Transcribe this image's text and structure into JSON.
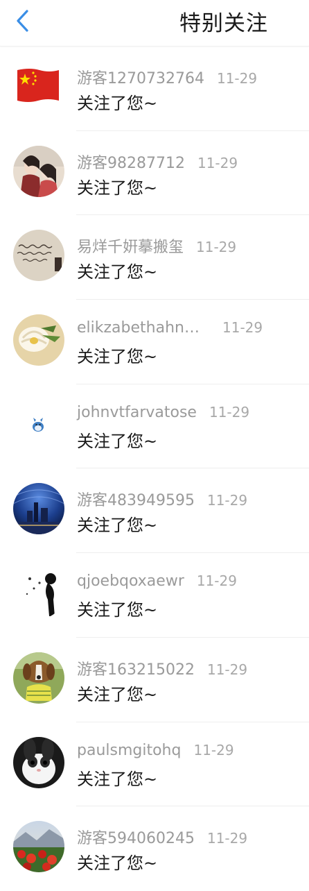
{
  "header": {
    "title": "特别关注",
    "back_icon": "chevron-left-icon",
    "accent_color": "#3a8ee6"
  },
  "items": [
    {
      "name": "游客1270732764",
      "time": "11-29",
      "message": "关注了您~",
      "avatar": "china-flag-avatar"
    },
    {
      "name": "游客98287712",
      "time": "11-29",
      "message": "关注了您~",
      "avatar": "anime-couple-avatar"
    },
    {
      "name": "易烊千姸摹搬玺",
      "time": "11-29",
      "message": "关注了您~",
      "avatar": "handwriting-avatar"
    },
    {
      "name": "elikzabethahn…",
      "time": "11-29",
      "message": "关注了您~",
      "avatar": "flower-avatar"
    },
    {
      "name": "johnvtfarvatose",
      "time": "11-29",
      "message": "关注了您~",
      "avatar": "totoro-avatar"
    },
    {
      "name": "游客483949595",
      "time": "11-29",
      "message": "关注了您~",
      "avatar": "night-city-avatar"
    },
    {
      "name": "qjoebqoxaewr",
      "time": "11-29",
      "message": "关注了您~",
      "avatar": "silhouette-avatar"
    },
    {
      "name": "游客163215022",
      "time": "11-29",
      "message": "关注了您~",
      "avatar": "beagle-avatar"
    },
    {
      "name": "paulsmgitohq",
      "time": "11-29",
      "message": "关注了您~",
      "avatar": "rabbit-avatar"
    },
    {
      "name": "游客594060245",
      "time": "11-29",
      "message": "关注了您~",
      "avatar": "red-flowers-avatar"
    }
  ]
}
